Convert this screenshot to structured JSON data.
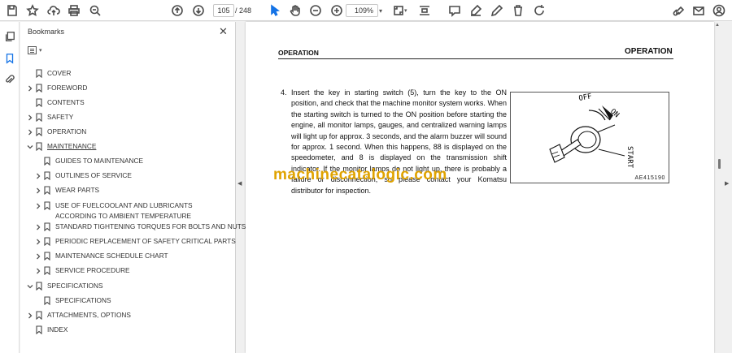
{
  "toolbar": {
    "page_current": "105",
    "page_total": "/  248",
    "zoom": "109%"
  },
  "panel": {
    "title": "Bookmarks",
    "close": "✕"
  },
  "bookmarks": [
    {
      "label": "COVER"
    },
    {
      "label": "FOREWORD"
    },
    {
      "label": "CONTENTS"
    },
    {
      "label": "SAFETY"
    },
    {
      "label": "OPERATION"
    },
    {
      "label": "MAINTENANCE"
    },
    {
      "label": "GUIDES TO MAINTENANCE"
    },
    {
      "label": "OUTLINES OF SERVICE"
    },
    {
      "label": "WEAR PARTS"
    },
    {
      "label": "USE OF FUELCOOLANT AND LUBRICANTS ACCORDING TO AMBIENT TEMPERATURE"
    },
    {
      "label": "STANDARD TIGHTENING TORQUES FOR BOLTS AND NUTS"
    },
    {
      "label": "PERIODIC REPLACEMENT OF SAFETY CRITICAL PARTS"
    },
    {
      "label": "MAINTENANCE SCHEDULE CHART"
    },
    {
      "label": "SERVICE PROCEDURE"
    },
    {
      "label": "SPECIFICATIONS"
    },
    {
      "label": "SPECIFICATIONS"
    },
    {
      "label": "ATTACHMENTS, OPTIONS"
    },
    {
      "label": "INDEX"
    }
  ],
  "document": {
    "header_left": "OPERATION",
    "header_right": "OPERATION",
    "step_number": "4.",
    "step_text": "Insert the key in starting switch (5), turn the key to the ON position, and check that the machine monitor system works. When the starting switch is turned to the ON position before starting the engine, all monitor lamps, gauges, and centralized warning lamps will light up for approx. 3 seconds, and the alarm buzzer will sound for approx. 1 second. When this happens, 88 is displayed on the speedometer, and 8 is displayed on the transmission shift indicator. If the monitor lamps do not light up, there is probably a failure or disconnection, so please contact your Komatsu distributor for inspection.",
    "watermark": "machinecatalogic.com",
    "figure": {
      "label_off": "OFF",
      "label_on": "ON",
      "label_start": "START",
      "code": "AE415190"
    }
  }
}
